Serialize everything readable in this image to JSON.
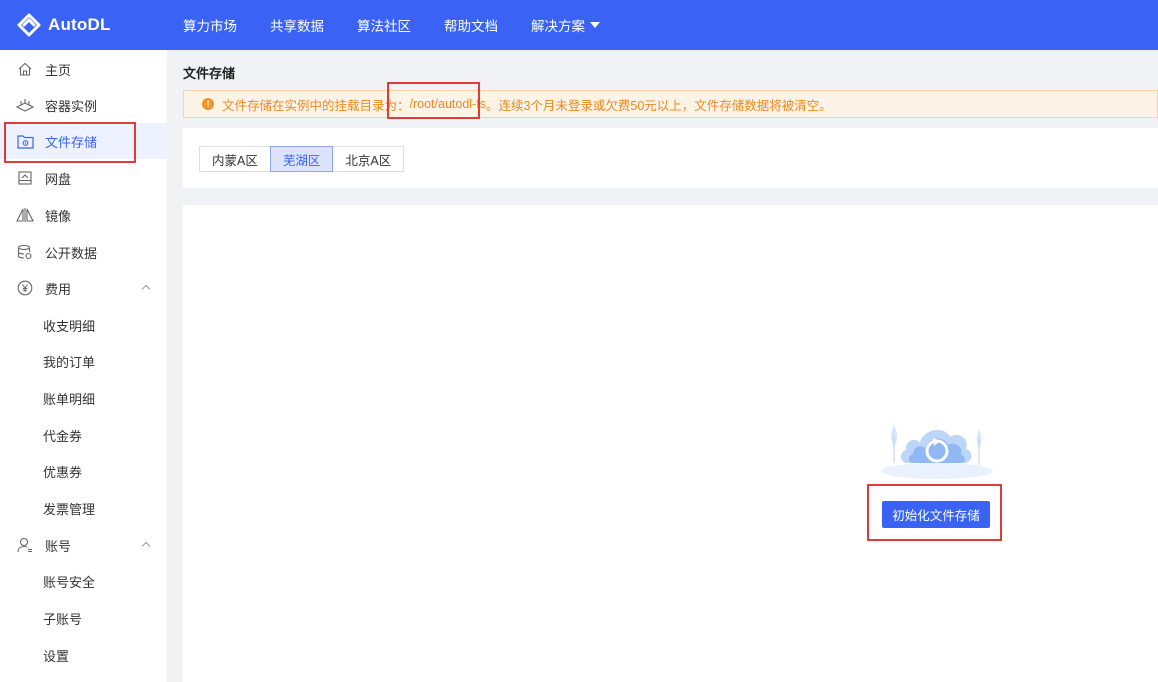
{
  "brand": {
    "name": "AutoDL",
    "logo_icon": "autodl-logo-icon"
  },
  "topnav": {
    "items": [
      {
        "label": "算力市场"
      },
      {
        "label": "共享数据"
      },
      {
        "label": "算法社区"
      },
      {
        "label": "帮助文档"
      },
      {
        "label": "解决方案",
        "has_dropdown": true
      }
    ]
  },
  "sidebar": {
    "items": [
      {
        "label": "主页",
        "icon": "home-icon"
      },
      {
        "label": "容器实例",
        "icon": "container-icon"
      },
      {
        "label": "文件存储",
        "icon": "folder-storage-icon",
        "active": true
      },
      {
        "label": "网盘",
        "icon": "disk-icon"
      },
      {
        "label": "镜像",
        "icon": "mirror-icon"
      },
      {
        "label": "公开数据",
        "icon": "database-icon"
      },
      {
        "label": "费用",
        "icon": "yen-icon",
        "expanded": true
      },
      {
        "label": "账号",
        "icon": "user-icon",
        "expanded": true
      }
    ],
    "fee_sub": [
      "收支明细",
      "我的订单",
      "账单明细",
      "代金券",
      "优惠券",
      "发票管理"
    ],
    "account_sub": [
      "账号安全",
      "子账号",
      "设置"
    ]
  },
  "page": {
    "title": "文件存储",
    "alert": {
      "prefix": "文件存储在实例中的挂载目录为：",
      "path": "/root/autodl-fs",
      "suffix": "。连续3个月未登录或欠费50元以上，文件存储数据将被清空。"
    },
    "regions": [
      {
        "label": "内蒙A区"
      },
      {
        "label": "芜湖区",
        "active": true
      },
      {
        "label": "北京A区"
      }
    ],
    "init_button": "初始化文件存储"
  },
  "colors": {
    "primary": "#3a63f5",
    "warning": "#ee8a1e",
    "highlight": "#e03b3b"
  }
}
